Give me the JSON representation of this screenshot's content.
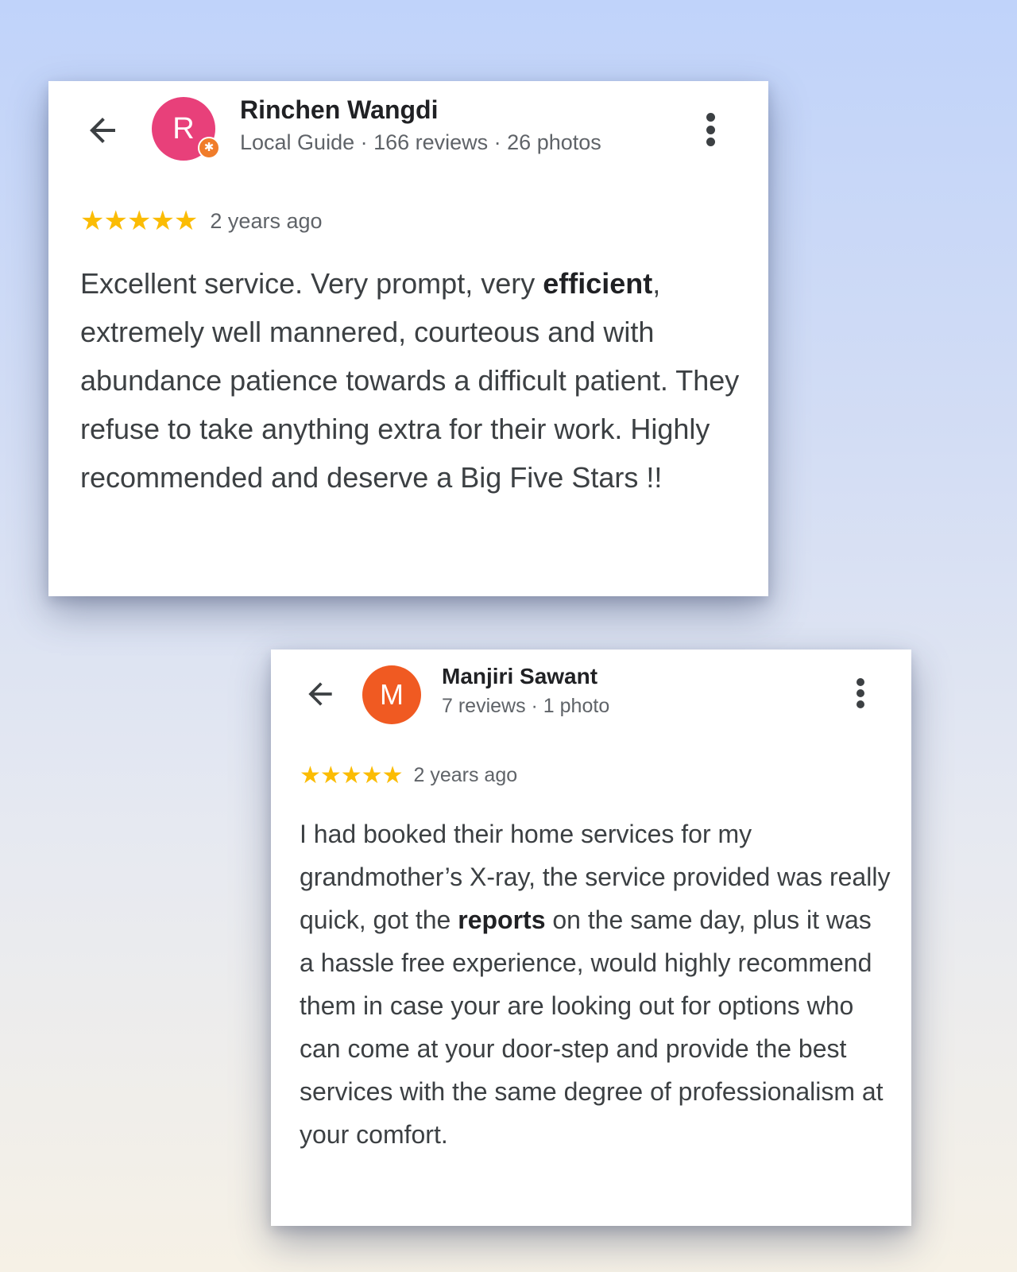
{
  "colors": {
    "star": "#fbbc04",
    "avatar_rinchen": "#e8407a",
    "avatar_manjiri": "#f05a22",
    "local_guide_badge": "#f07c2a",
    "name_text": "#202124",
    "meta_text": "#5f6368",
    "body_text": "#3c4043"
  },
  "reviews": [
    {
      "avatar_letter": "R",
      "local_guide_badge_icon": "local-guide-star-icon",
      "name": "Rinchen Wangdi",
      "meta": "Local Guide · 166 reviews · 26 photos",
      "stars": "★★★★★",
      "rating": 5,
      "time": "2 years ago",
      "text_before": "Excellent service. Very prompt, very ",
      "text_bold": "efficient",
      "text_after": ", extremely well mannered, courteous and with abundance patience towards a difficult patient. They refuse to take anything extra for their work. Highly recommended and deserve a Big Five Stars !!"
    },
    {
      "avatar_letter": "M",
      "name": "Manjiri Sawant",
      "meta": "7 reviews · 1 photo",
      "stars": "★★★★★",
      "rating": 5,
      "time": "2 years ago",
      "text_before": "I had booked their home services for my grandmother’s X-ray, the service provided was really quick, got the ",
      "text_bold": "reports",
      "text_after": " on the same day, plus it was a hassle free experience, would highly recommend them in case your are looking out for options who can come at your door-step and provide the best services with the same degree of professionalism at your comfort."
    }
  ]
}
